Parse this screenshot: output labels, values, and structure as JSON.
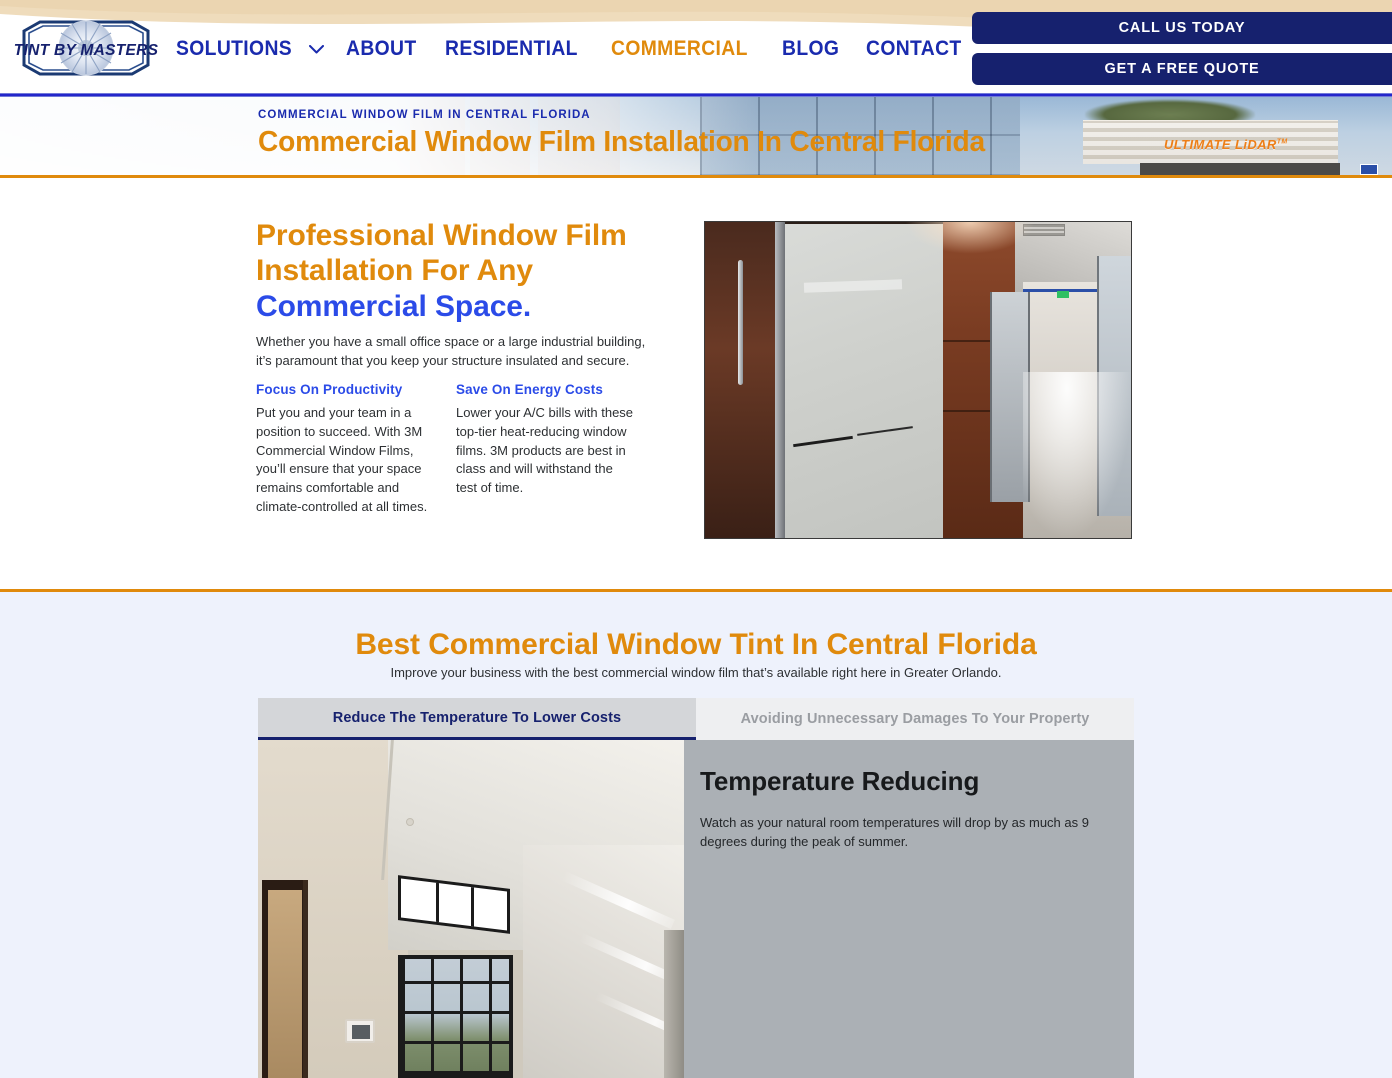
{
  "brand": {
    "logo_text": "TINT BY MASTERS",
    "logo_icon": "starburst-badge-icon"
  },
  "nav": {
    "items": [
      {
        "label": "SOLUTIONS",
        "active": false,
        "has_caret": true
      },
      {
        "label": "ABOUT",
        "active": false,
        "has_caret": false
      },
      {
        "label": "RESIDENTIAL",
        "active": false,
        "has_caret": false
      },
      {
        "label": "COMMERCIAL",
        "active": true,
        "has_caret": false
      },
      {
        "label": "BLOG",
        "active": false,
        "has_caret": false
      },
      {
        "label": "CONTACT",
        "active": false,
        "has_caret": false
      }
    ],
    "caret_icon": "chevron-down-icon"
  },
  "cta": {
    "call_label": "CALL US TODAY",
    "quote_label": "GET A FREE QUOTE"
  },
  "hero": {
    "eyebrow": "COMMERCIAL WINDOW FILM IN CENTRAL FLORIDA",
    "title": "Commercial Window Film Installation In Central Florida",
    "background_sign_text": "ULTIMATE LiDAR",
    "background_sign_tm": "TM"
  },
  "intro": {
    "heading_line1": "Professional Window Film",
    "heading_line2": "Installation For Any",
    "heading_line3": "Commercial Space.",
    "lead": "Whether you have a small office space or a large industrial building, it’s paramount that you keep your structure insulated and secure.",
    "columns": [
      {
        "heading": "Focus On Productivity",
        "body": "Put you and your team in a position to succeed. With 3M Commercial Window Films, you’ll ensure that your space remains comfortable and climate-controlled at all times."
      },
      {
        "heading": "Save On Energy Costs",
        "body": "Lower your A/C bills with these top-tier heat-reducing window films. 3M products are best in class and will withstand the test of time."
      }
    ],
    "photo_alt": "office-hallway-glass-doors-photo"
  },
  "best": {
    "heading": "Best Commercial Window Tint In Central Florida",
    "subheading": "Improve your business with the best commercial window film that’s available right here in Greater Orlando.",
    "tabs": [
      {
        "label": "Reduce The Temperature To Lower Costs",
        "active": true
      },
      {
        "label": "Avoiding Unnecessary Damages To Your Property",
        "active": false
      }
    ],
    "panel": {
      "title": "Temperature Reducing",
      "body": "Watch as your natural room temperatures will drop by as much as 9 degrees during the peak of summer.",
      "photo_alt": "high-ceiling-room-window-daylight-photo"
    }
  },
  "colors": {
    "brand_blue": "#1A2BAE",
    "deep_navy": "#16216E",
    "accent_orange": "#E08A0C",
    "link_blue": "#2B4BE8",
    "section_bg": "#EEF2FC",
    "tab_active_bg": "#D4D6D9",
    "tab_inactive_bg": "#EEEFF1",
    "panel_bg": "#ABB0B5",
    "beige_wave": "#EFDCBC"
  }
}
